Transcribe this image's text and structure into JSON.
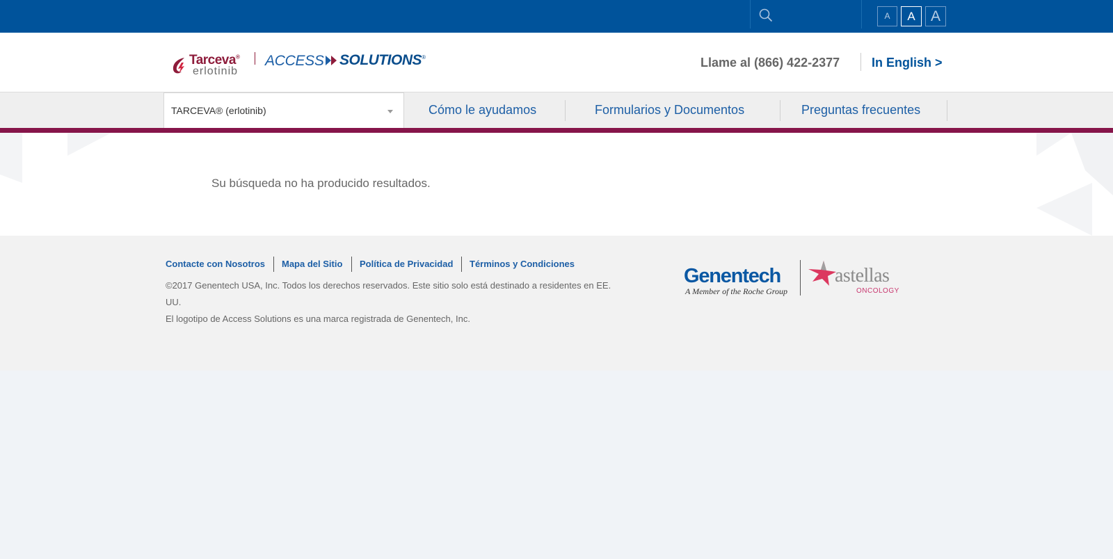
{
  "topbar": {
    "search_placeholder": "",
    "font_sizes": [
      "A",
      "A",
      "A"
    ]
  },
  "header": {
    "brand_name": "Tarceva",
    "brand_mark": "®",
    "brand_generic": "erlotinib",
    "access_word": "ACCESS",
    "solutions_word": "SOLUTIONS",
    "solutions_mark": "®",
    "phone": "Llame al (866) 422-2377",
    "language_link": "In English >"
  },
  "nav": {
    "product_select": "TARCEVA® (erlotinib)",
    "items": [
      {
        "label": "Cómo le ayudamos"
      },
      {
        "label": "Formularios y Documentos"
      },
      {
        "label": "Preguntas frecuentes"
      }
    ]
  },
  "main": {
    "message": "Su búsqueda no ha producido resultados."
  },
  "footer": {
    "links": [
      {
        "label": "Contacte con Nosotros"
      },
      {
        "label": "Mapa del Sitio"
      },
      {
        "label": "Política de Privacidad"
      },
      {
        "label": "Términos y Condiciones"
      }
    ],
    "copyright": "©2017 Genentech USA, Inc. Todos los derechos reservados.  Este sitio solo está destinado a residentes en EE. UU.",
    "trademark": "El logotipo de Access Solutions es una marca registrada de Genentech, Inc.",
    "genentech": "Genentech",
    "genentech_tagline": "A Member of the Roche Group",
    "astellas": "astellas",
    "oncology": "ONCOLOGY"
  },
  "colors": {
    "topbar": "#00539b",
    "accent_bar": "#86154a",
    "link_blue": "#1d5fa6",
    "brand_red": "#8e1c3b"
  },
  "icons": {
    "search": "search-icon",
    "dropdown": "chevron-down-icon"
  }
}
